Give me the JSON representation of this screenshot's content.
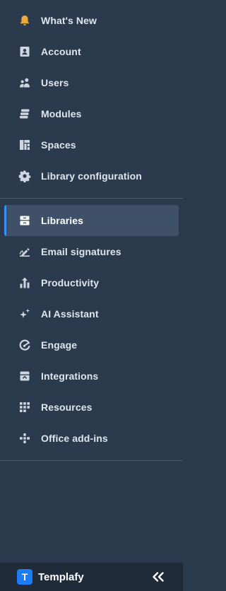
{
  "colors": {
    "background": "#2b3a4c",
    "active_background": "#3e5169",
    "active_accent": "#3a8ef6",
    "icon": "#cfd6df",
    "notification_icon": "#e9a93b",
    "footer_background": "#1f2b39",
    "brand": "#1c7cf4"
  },
  "nav_top": [
    {
      "label": "What's New",
      "icon": "bell-icon"
    },
    {
      "label": "Account",
      "icon": "id-card-icon"
    },
    {
      "label": "Users",
      "icon": "users-icon"
    },
    {
      "label": "Modules",
      "icon": "modules-icon"
    },
    {
      "label": "Spaces",
      "icon": "spaces-icon"
    },
    {
      "label": "Library configuration",
      "icon": "gear-icon"
    }
  ],
  "nav_main": [
    {
      "label": "Libraries",
      "icon": "archive-icon",
      "active": true
    },
    {
      "label": "Email signatures",
      "icon": "signature-icon"
    },
    {
      "label": "Productivity",
      "icon": "productivity-icon"
    },
    {
      "label": "AI Assistant",
      "icon": "sparkles-icon"
    },
    {
      "label": "Engage",
      "icon": "engage-icon"
    },
    {
      "label": "Integrations",
      "icon": "integrations-icon"
    },
    {
      "label": "Resources",
      "icon": "resources-icon"
    },
    {
      "label": "Office add-ins",
      "icon": "puzzle-icon"
    }
  ],
  "footer": {
    "logo_letter": "T",
    "brand_name": "Templafy",
    "collapse_icon": "double-chevron-left-icon"
  }
}
